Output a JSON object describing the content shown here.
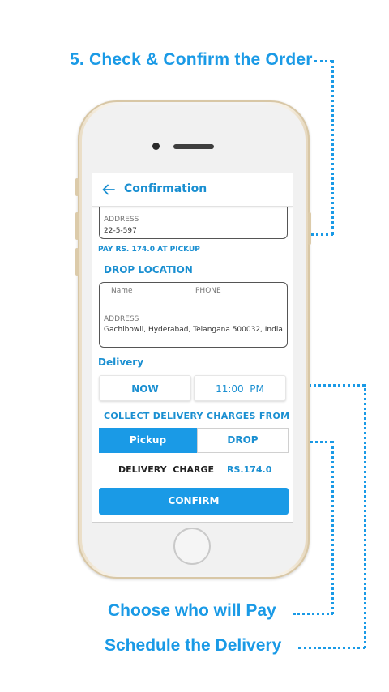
{
  "captions": {
    "check_confirm": "5. Check & Confirm the Order",
    "choose_pay": "Choose who will Pay",
    "schedule": "Schedule the Delivery"
  },
  "header": {
    "title": "Confirmation",
    "back_icon": "arrow-left-icon"
  },
  "pickup": {
    "address_label": "ADDRESS",
    "address_value": "22-5-597",
    "pay_note": "PAY RS. 174.0 AT PICKUP"
  },
  "drop": {
    "section_title": "DROP LOCATION",
    "name_label": "Name",
    "phone_label": "PHONE",
    "address_label": "ADDRESS",
    "address_value": "Gachibowli, Hyderabad, Telangana 500032, India"
  },
  "delivery": {
    "section_title": "Delivery",
    "now_label": "NOW",
    "time_label": "11:00  PM"
  },
  "charges": {
    "section_title": "COLLECT DELIVERY CHARGES FROM",
    "pickup_label": "Pickup",
    "drop_label": "DROP",
    "selected": "Pickup",
    "delivery_charge_label": "DELIVERY  CHARGE",
    "delivery_charge_value": "RS.174.0"
  },
  "confirm_label": "CONFIRM",
  "colors": {
    "accent": "#1a8fd1",
    "caption": "#1a9ae6",
    "selected_bg": "#1a9ae6"
  }
}
